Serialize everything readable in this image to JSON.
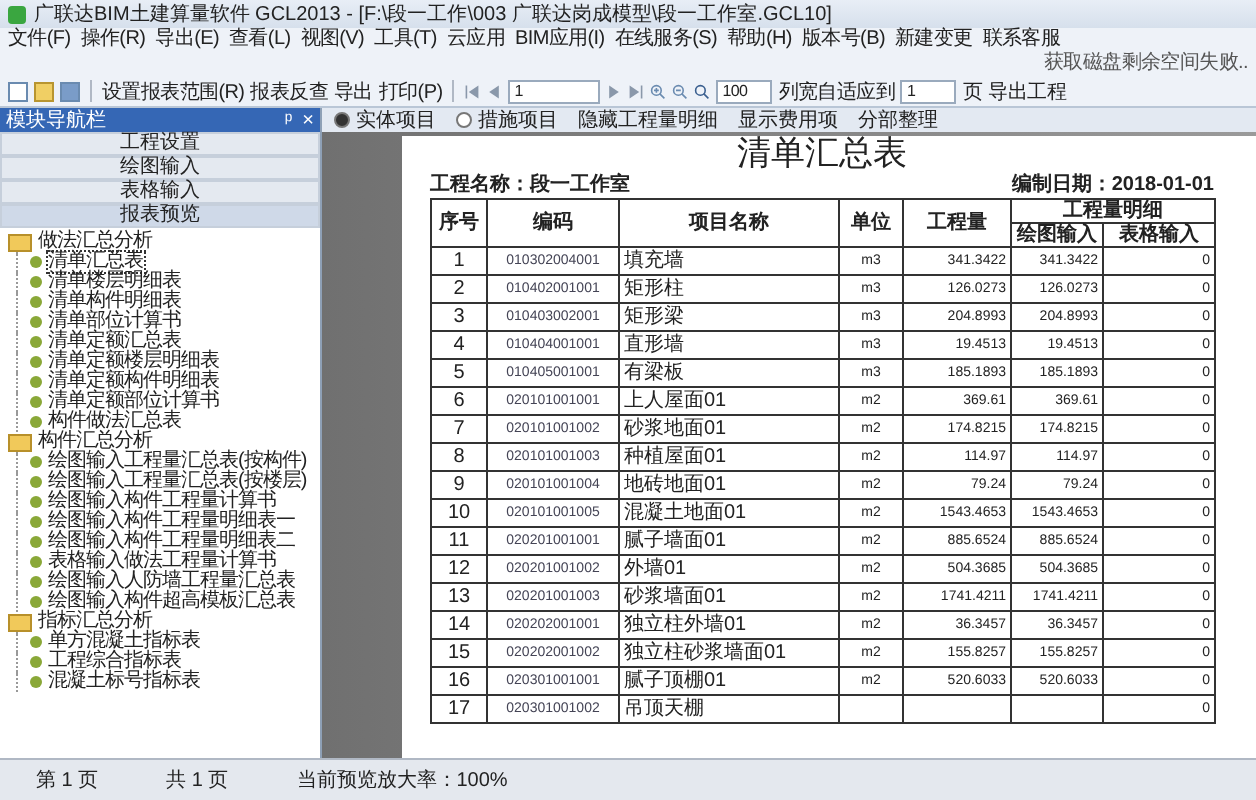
{
  "window": {
    "title": "广联达BIM土建算量软件 GCL2013 - [F:\\段一工作\\003 广联达岗成模型\\段一工作室.GCL10]"
  },
  "menu": [
    "文件(F)",
    "操作(R)",
    "导出(E)",
    "查看(L)",
    "视图(V)",
    "工具(T)",
    "云应用",
    "BIM应用(I)",
    "在线服务(S)",
    "帮助(H)",
    "版本号(B)"
  ],
  "menu_actions": [
    "新建变更",
    "联系客服"
  ],
  "menu_status": "获取磁盘剩余空间失败..",
  "toolbar": {
    "buttons": [
      "设置报表范围(R)",
      "报表反查",
      "导出",
      "打印(P)"
    ],
    "page": "1",
    "zoom": "100",
    "fit_label": "列宽自适应到",
    "fit_value": "1",
    "fit_unit": "页",
    "export": "导出工程"
  },
  "nav": {
    "title": "模块导航栏",
    "pin": "ᵖ",
    "close": "×",
    "modules": [
      {
        "label": "工程设置",
        "selected": false
      },
      {
        "label": "绘图输入",
        "selected": false
      },
      {
        "label": "表格输入",
        "selected": false
      },
      {
        "label": "报表预览",
        "selected": true
      }
    ],
    "tree": [
      {
        "label": "做法汇总分析",
        "children": [
          {
            "label": "清单汇总表",
            "selected": true
          },
          {
            "label": "清单楼层明细表",
            "selected": false
          },
          {
            "label": "清单构件明细表",
            "selected": false
          },
          {
            "label": "清单部位计算书",
            "selected": false
          },
          {
            "label": "清单定额汇总表",
            "selected": false
          },
          {
            "label": "清单定额楼层明细表",
            "selected": false
          },
          {
            "label": "清单定额构件明细表",
            "selected": false
          },
          {
            "label": "清单定额部位计算书",
            "selected": false
          },
          {
            "label": "构件做法汇总表",
            "selected": false
          }
        ]
      },
      {
        "label": "构件汇总分析",
        "children": [
          {
            "label": "绘图输入工程量汇总表(按构件)",
            "selected": false
          },
          {
            "label": "绘图输入工程量汇总表(按楼层)",
            "selected": false
          },
          {
            "label": "绘图输入构件工程量计算书",
            "selected": false
          },
          {
            "label": "绘图输入构件工程量明细表一",
            "selected": false
          },
          {
            "label": "绘图输入构件工程量明细表二",
            "selected": false
          },
          {
            "label": "表格输入做法工程量计算书",
            "selected": false
          },
          {
            "label": "绘图输入人防墙工程量汇总表",
            "selected": false
          },
          {
            "label": "绘图输入构件超高模板汇总表",
            "selected": false
          }
        ]
      },
      {
        "label": "指标汇总分析",
        "children": [
          {
            "label": "单方混凝土指标表",
            "selected": false
          },
          {
            "label": "工程综合指标表",
            "selected": false
          },
          {
            "label": "混凝土标号指标表",
            "selected": false
          }
        ]
      }
    ]
  },
  "subtoolbar": {
    "options": [
      {
        "label": "实体项目",
        "selected": true
      },
      {
        "label": "措施项目",
        "selected": false
      }
    ],
    "buttons": [
      "隐藏工程量明细",
      "显示费用项",
      "分部整理"
    ]
  },
  "report": {
    "title": "清单汇总表",
    "project": "工程名称：段一工作室",
    "date": "编制日期：2018-01-01",
    "columns": [
      "序号",
      "编码",
      "项目名称",
      "单位",
      "工程量"
    ],
    "group": "工程量明细",
    "subcolumns": [
      "绘图输入",
      "表格输入"
    ],
    "rows": [
      {
        "no": "1",
        "code": "010302004001",
        "name": "填充墙",
        "unit": "m3",
        "qty": "341.3422",
        "drawn": "341.3422",
        "table": "0"
      },
      {
        "no": "2",
        "code": "010402001001",
        "name": "矩形柱",
        "unit": "m3",
        "qty": "126.0273",
        "drawn": "126.0273",
        "table": "0"
      },
      {
        "no": "3",
        "code": "010403002001",
        "name": "矩形梁",
        "unit": "m3",
        "qty": "204.8993",
        "drawn": "204.8993",
        "table": "0"
      },
      {
        "no": "4",
        "code": "010404001001",
        "name": "直形墙",
        "unit": "m3",
        "qty": "19.4513",
        "drawn": "19.4513",
        "table": "0"
      },
      {
        "no": "5",
        "code": "010405001001",
        "name": "有梁板",
        "unit": "m3",
        "qty": "185.1893",
        "drawn": "185.1893",
        "table": "0"
      },
      {
        "no": "6",
        "code": "020101001001",
        "name": "上人屋面01",
        "unit": "m2",
        "qty": "369.61",
        "drawn": "369.61",
        "table": "0"
      },
      {
        "no": "7",
        "code": "020101001002",
        "name": "砂浆地面01",
        "unit": "m2",
        "qty": "174.8215",
        "drawn": "174.8215",
        "table": "0"
      },
      {
        "no": "8",
        "code": "020101001003",
        "name": "种植屋面01",
        "unit": "m2",
        "qty": "114.97",
        "drawn": "114.97",
        "table": "0"
      },
      {
        "no": "9",
        "code": "020101001004",
        "name": "地砖地面01",
        "unit": "m2",
        "qty": "79.24",
        "drawn": "79.24",
        "table": "0"
      },
      {
        "no": "10",
        "code": "020101001005",
        "name": "混凝土地面01",
        "unit": "m2",
        "qty": "1543.4653",
        "drawn": "1543.4653",
        "table": "0"
      },
      {
        "no": "11",
        "code": "020201001001",
        "name": "腻子墙面01",
        "unit": "m2",
        "qty": "885.6524",
        "drawn": "885.6524",
        "table": "0"
      },
      {
        "no": "12",
        "code": "020201001002",
        "name": "外墙01",
        "unit": "m2",
        "qty": "504.3685",
        "drawn": "504.3685",
        "table": "0"
      },
      {
        "no": "13",
        "code": "020201001003",
        "name": "砂浆墙面01",
        "unit": "m2",
        "qty": "1741.4211",
        "drawn": "1741.4211",
        "table": "0"
      },
      {
        "no": "14",
        "code": "020202001001",
        "name": "独立柱外墙01",
        "unit": "m2",
        "qty": "36.3457",
        "drawn": "36.3457",
        "table": "0"
      },
      {
        "no": "15",
        "code": "020202001002",
        "name": "独立柱砂浆墙面01",
        "unit": "m2",
        "qty": "155.8257",
        "drawn": "155.8257",
        "table": "0"
      },
      {
        "no": "16",
        "code": "020301001001",
        "name": "腻子顶棚01",
        "unit": "m2",
        "qty": "520.6033",
        "drawn": "520.6033",
        "table": "0"
      },
      {
        "no": "17",
        "code": "020301001002",
        "name": "吊顶天棚",
        "table": "0"
      }
    ]
  },
  "status_bar": {
    "page": "第 1 页",
    "total": "共 1 页",
    "zoom": "当前预览放大率：100%"
  }
}
